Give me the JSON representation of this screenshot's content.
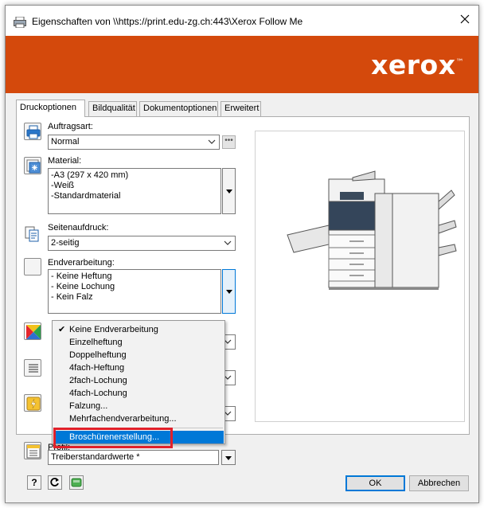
{
  "window": {
    "title": "Eigenschaften von \\\\https://print.edu-zg.ch:443\\Xerox Follow Me",
    "brand_logo": "xerox",
    "brand_color": "#d4490c",
    "accent_color": "#0078d7"
  },
  "tabs": [
    {
      "label": "Druckoptionen",
      "active": true
    },
    {
      "label": "Bildqualität",
      "active": false
    },
    {
      "label": "Dokumentoptionen",
      "active": false
    },
    {
      "label": "Erweitert",
      "active": false
    }
  ],
  "fields": {
    "auftragsart": {
      "label": "Auftragsart:",
      "value": "Normal",
      "icon": "printer-icon"
    },
    "material": {
      "label": "Material:",
      "lines": [
        "-A3 (297 x 420 mm)",
        "-Weiß",
        "-Standardmaterial"
      ],
      "icon": "paper-stack-icon"
    },
    "seitenaufdruck": {
      "label": "Seitenaufdruck:",
      "value": "2-seitig",
      "icon": "duplex-pages-icon"
    },
    "endverarbeitung": {
      "label": "Endverarbeitung:",
      "lines": [
        "- Keine Heftung",
        "- Keine Lochung",
        "- Kein Falz"
      ],
      "icon": "finishing-icon"
    },
    "profil": {
      "label": "Profil:",
      "value": "Treiberstandardwerte *",
      "icon": "profile-list-icon"
    }
  },
  "dropdown": {
    "items": [
      {
        "label": "Keine Endverarbeitung",
        "checked": true,
        "selected": false
      },
      {
        "label": "Einzelheftung",
        "checked": false,
        "selected": false
      },
      {
        "label": "Doppelheftung",
        "checked": false,
        "selected": false
      },
      {
        "label": "4fach-Heftung",
        "checked": false,
        "selected": false
      },
      {
        "label": "2fach-Lochung",
        "checked": false,
        "selected": false
      },
      {
        "label": "4fach-Lochung",
        "checked": false,
        "selected": false
      },
      {
        "label": "Falzung...",
        "checked": false,
        "selected": false
      },
      {
        "label": "Mehrfachendverarbeitung...",
        "checked": false,
        "selected": false
      },
      {
        "label": "Broschürenerstellung...",
        "checked": false,
        "selected": true
      }
    ],
    "highlight_color": "#e0202a"
  },
  "bottom": {
    "help_label": "?",
    "ok_label": "OK",
    "cancel_label": "Abbrechen"
  }
}
